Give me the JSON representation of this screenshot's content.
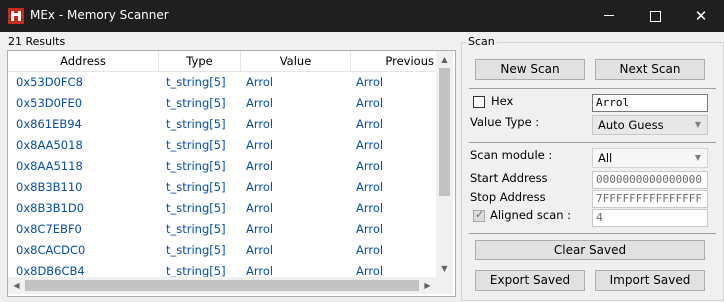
{
  "window": {
    "title": "MEx - Memory Scanner"
  },
  "results": {
    "count_label": "21 Results",
    "columns": [
      "Address",
      "Type",
      "Value",
      "Previous"
    ],
    "rows": [
      {
        "address": "0x53D0FC8",
        "type": "t_string[5]",
        "value": "Arrol",
        "previous": "Arrol"
      },
      {
        "address": "0x53D0FE0",
        "type": "t_string[5]",
        "value": "Arrol",
        "previous": "Arrol"
      },
      {
        "address": "0x861EB94",
        "type": "t_string[5]",
        "value": "Arrol",
        "previous": "Arrol"
      },
      {
        "address": "0x8AA5018",
        "type": "t_string[5]",
        "value": "Arrol",
        "previous": "Arrol"
      },
      {
        "address": "0x8AA5118",
        "type": "t_string[5]",
        "value": "Arrol",
        "previous": "Arrol"
      },
      {
        "address": "0x8B3B110",
        "type": "t_string[5]",
        "value": "Arrol",
        "previous": "Arrol"
      },
      {
        "address": "0x8B3B1D0",
        "type": "t_string[5]",
        "value": "Arrol",
        "previous": "Arrol"
      },
      {
        "address": "0x8C7EBF0",
        "type": "t_string[5]",
        "value": "Arrol",
        "previous": "Arrol"
      },
      {
        "address": "0x8CACDC0",
        "type": "t_string[5]",
        "value": "Arrol",
        "previous": "Arrol"
      },
      {
        "address": "0x8DB6CB4",
        "type": "t_string[5]",
        "value": "Arrol",
        "previous": "Arrol"
      }
    ]
  },
  "scan": {
    "group_label": "Scan",
    "new_scan": "New Scan",
    "next_scan": "Next Scan",
    "hex_label": "Hex",
    "hex_checked": false,
    "search_value": "Arrol",
    "value_type_label": "Value Type :",
    "value_type": "Auto Guess",
    "scan_module_label": "Scan module :",
    "scan_module": "All",
    "start_address_label": "Start Address",
    "start_address": "0000000000000000",
    "stop_address_label": "Stop Address",
    "stop_address": "7FFFFFFFFFFFFFFF",
    "aligned_label": "Aligned scan :",
    "aligned_checked": true,
    "alignment": "4",
    "clear_saved": "Clear Saved",
    "export_saved": "Export Saved",
    "import_saved": "Import Saved"
  },
  "icons": {
    "app": "app-logo-icon",
    "minimize": "minimize-icon",
    "maximize": "maximize-icon",
    "close": "close-icon",
    "scroll_up": "scroll-up-arrow-icon",
    "scroll_down": "scroll-down-arrow-icon",
    "scroll_left": "scroll-left-arrow-icon",
    "scroll_right": "scroll-right-arrow-icon",
    "dropdown": "chevron-down-icon"
  },
  "colors": {
    "titlebar": "#1f1f1f",
    "app_icon": "#c42b1c",
    "row_text": "#0b4ea2"
  }
}
